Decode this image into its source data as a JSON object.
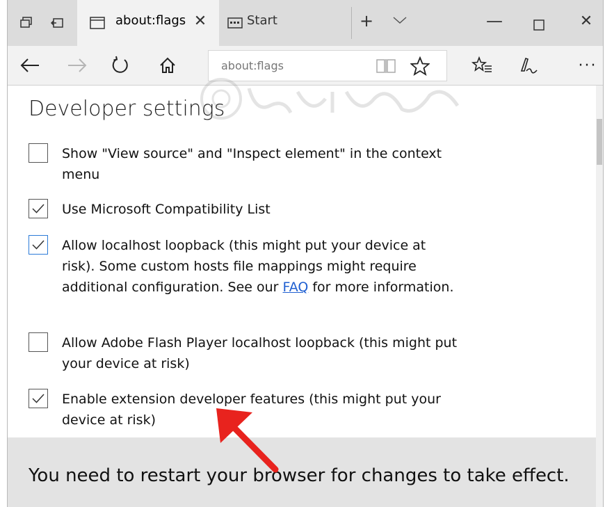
{
  "tabs": [
    {
      "label": "about:flags",
      "active": true
    },
    {
      "label": "Start",
      "active": false
    }
  ],
  "toolbar_icons": [
    "tab-overview-icon",
    "set-aside-tabs-icon",
    "new-tab-plus-icon",
    "tab-preview-chevron-icon",
    "minimize-icon",
    "maximize-icon",
    "close-window-icon"
  ],
  "address": {
    "url": "about:flags"
  },
  "page": {
    "title": "Developer settings",
    "options": [
      {
        "text": "Show \"View source\" and \"Inspect element\" in the context menu",
        "checked": false
      },
      {
        "text": "Use Microsoft Compatibility List",
        "checked": true
      },
      {
        "text_before": "Allow localhost loopback (this might put your device at risk). Some custom hosts file mappings might require additional configuration. See our ",
        "link": "FAQ",
        "text_after": " for more information.",
        "checked": true
      },
      {
        "text": "Allow Adobe Flash Player localhost loopback (this might put your device at risk)",
        "checked": false
      },
      {
        "text": "Enable extension developer features (this might put your device at risk)",
        "checked": true
      }
    ],
    "restart_message": "You need to restart your browser for changes to take effect."
  },
  "colors": {
    "tabbar": "#dcdcdc",
    "accent_focus": "#2b7bd8",
    "link": "#1f5fd1",
    "arrow": "#e8231e"
  }
}
